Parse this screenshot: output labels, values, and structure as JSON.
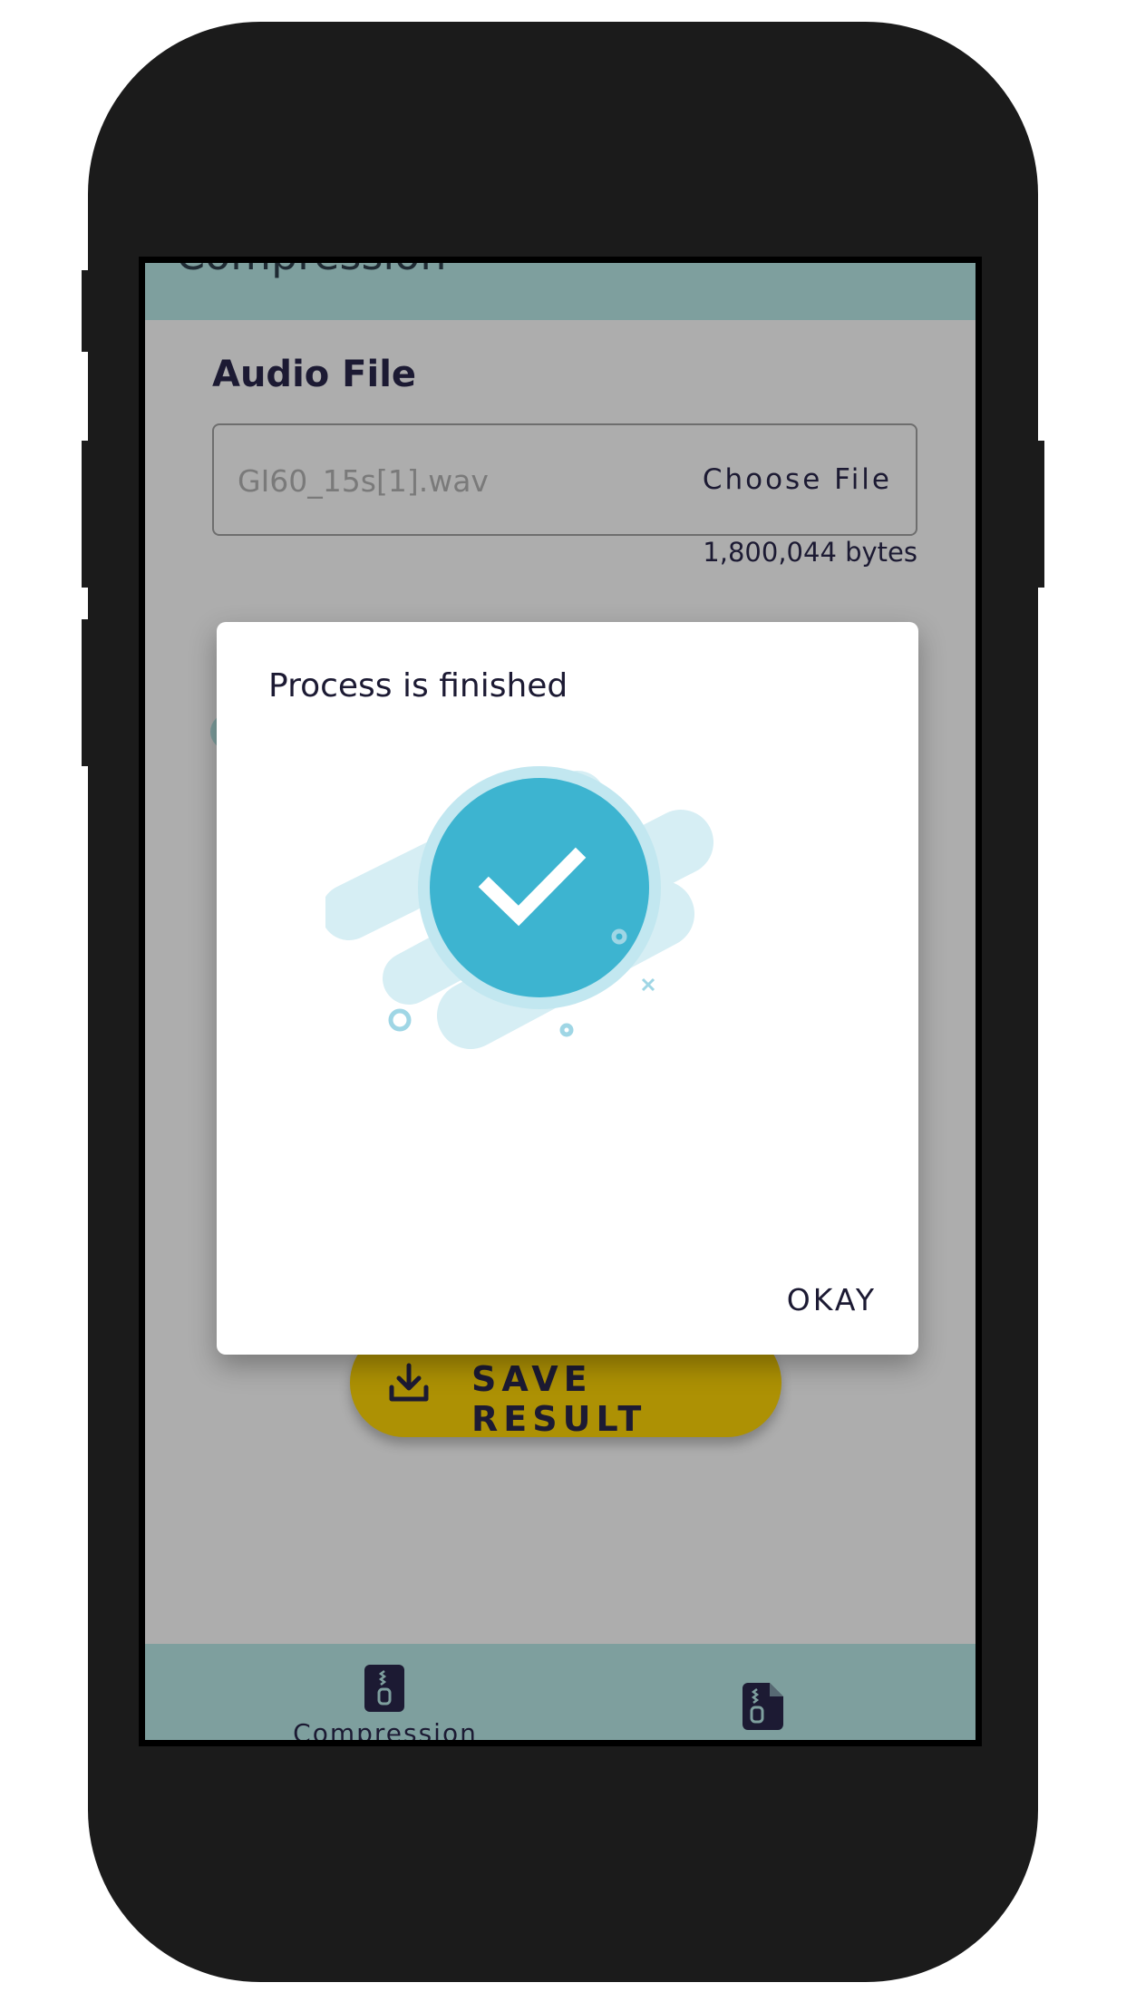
{
  "app": {
    "header_title": "Compression"
  },
  "audio": {
    "section_label": "Audio File",
    "file_name": "GI60_15s[1].wav",
    "choose_label": "Choose File",
    "size": "1,800,044 bytes"
  },
  "actions": {
    "save_label": "SAVE RESULT"
  },
  "bottom_nav": {
    "items": [
      {
        "label": "Compression",
        "icon": "zip-file-icon"
      },
      {
        "label": "",
        "icon": "zip-document-icon"
      }
    ]
  },
  "dialog": {
    "title": "Process is finished",
    "illustration": "success-checkmark-icon",
    "ok_label": "OKAY"
  },
  "colors": {
    "teal_bar": "#7e9f9e",
    "overlay_grey": "#adadad",
    "save_gold": "#ad9104",
    "check_blue": "#3db4d0",
    "light_blue": "#d6eef4"
  }
}
